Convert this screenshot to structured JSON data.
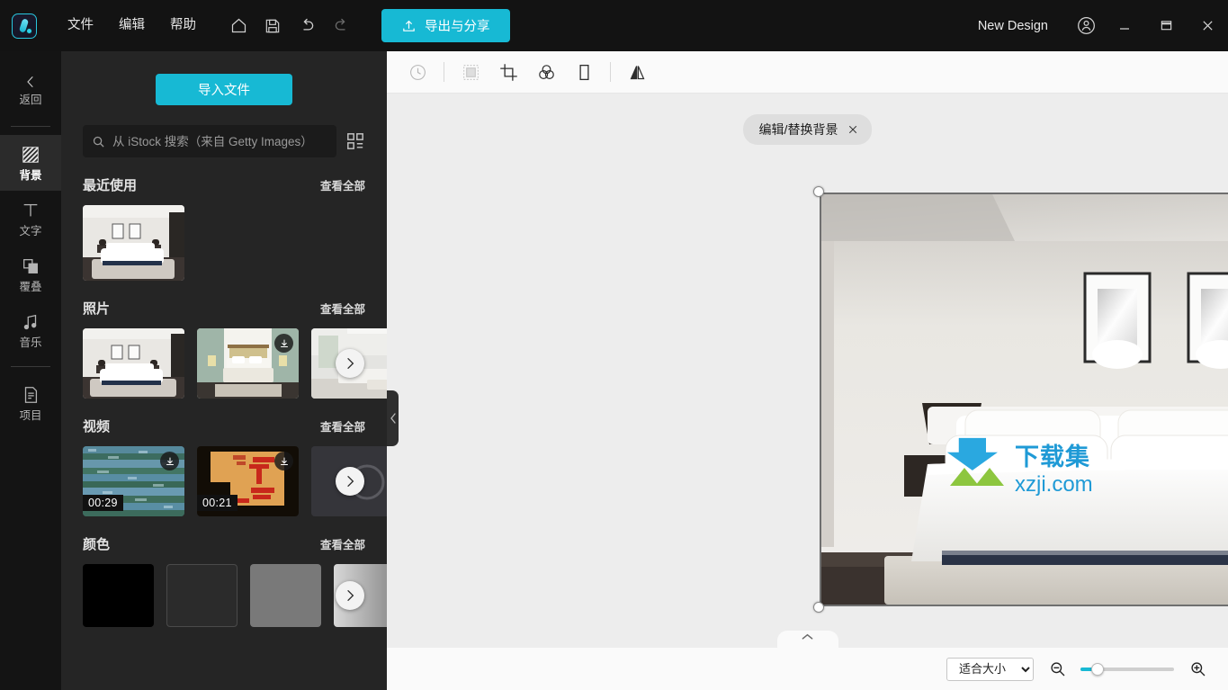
{
  "titlebar": {
    "logo_icon": "app-logo-icon",
    "menus": [
      "文件",
      "编辑",
      "帮助"
    ],
    "icons": [
      "home-icon",
      "save-icon",
      "undo-icon",
      "redo-icon"
    ],
    "export_label": "导出与分享",
    "export_icon": "upload-icon",
    "doc_title": "New Design",
    "account_icon": "account-circle-icon",
    "minimize_icon": "minimize-icon",
    "maximize_icon": "maximize-icon",
    "close_icon": "close-icon",
    "accent_color": "#17b9d4",
    "bg_color": "#131313"
  },
  "rail": {
    "back": {
      "label": "返回",
      "icon": "chevron-left-icon"
    },
    "items": [
      {
        "label": "背景",
        "icon": "background-hatch-icon",
        "active": true
      },
      {
        "label": "文字",
        "icon": "text-t-icon",
        "active": false
      },
      {
        "label": "覆叠",
        "icon": "overlay-layers-icon",
        "active": false
      },
      {
        "label": "音乐",
        "icon": "music-note-icon",
        "active": false
      },
      {
        "label": "项目",
        "icon": "document-icon",
        "active": false
      }
    ]
  },
  "left_panel": {
    "import_button": "导入文件",
    "search": {
      "placeholder": "从 iStock 搜索（来自 Getty Images）",
      "value": "",
      "icon": "search-icon",
      "grid_icon": "grid-view-icon"
    },
    "sections": [
      {
        "title": "最近使用",
        "more_label": "查看全部",
        "kind": "recent",
        "items": [
          {
            "name": "bedroom-white",
            "download": false,
            "duration": ""
          }
        ]
      },
      {
        "title": "照片",
        "more_label": "查看全部",
        "kind": "photo",
        "items": [
          {
            "name": "bedroom-white",
            "download": false,
            "duration": ""
          },
          {
            "name": "bedroom-wood",
            "download": true,
            "duration": ""
          },
          {
            "name": "living-room",
            "download": false,
            "duration": ""
          }
        ]
      },
      {
        "title": "视频",
        "more_label": "查看全部",
        "kind": "video",
        "items": [
          {
            "name": "water-ripples",
            "download": true,
            "duration": "00:29"
          },
          {
            "name": "orange-film",
            "download": true,
            "duration": "00:21"
          },
          {
            "name": "third-clip",
            "download": false,
            "duration": ""
          }
        ]
      },
      {
        "title": "颜色",
        "more_label": "查看全部",
        "kind": "color",
        "items": [
          {
            "name": "black",
            "color": "#000000"
          },
          {
            "name": "dark-gray",
            "color": "#2b2b2b"
          },
          {
            "name": "mid-gray",
            "color": "#797979"
          },
          {
            "name": "gradient-gray",
            "color": "#9a9a9a"
          }
        ]
      }
    ],
    "next_arrow_icon": "chevron-right-icon",
    "download_icon": "download-icon",
    "collapse_icon": "chevron-left-icon"
  },
  "canvas": {
    "toolbar_icons": [
      "clock-history-icon",
      "fit-frame-icon",
      "crop-icon",
      "color-adjust-icon",
      "aspect-portrait-icon",
      "flip-horizontal-icon"
    ],
    "chip": {
      "label": "编辑/替换背景",
      "close_icon": "close-icon"
    },
    "selection": {
      "handles": [
        "top-left",
        "top-right",
        "bottom-left",
        "bottom-right"
      ]
    },
    "bottom_handle_icon": "chevron-up-icon",
    "watermark": {
      "line1": "下载集",
      "line2": "xzji.com",
      "icon": "download-arrow-logo"
    }
  },
  "bottom_bar": {
    "fit_select": {
      "value": "适合大小",
      "options": [
        "适合大小"
      ],
      "caret_icon": "chevron-down-icon"
    },
    "zoom_out_icon": "zoom-out-icon",
    "zoom_in_icon": "zoom-in-icon",
    "slider_value": 12,
    "accent_color": "#17b9d4"
  }
}
